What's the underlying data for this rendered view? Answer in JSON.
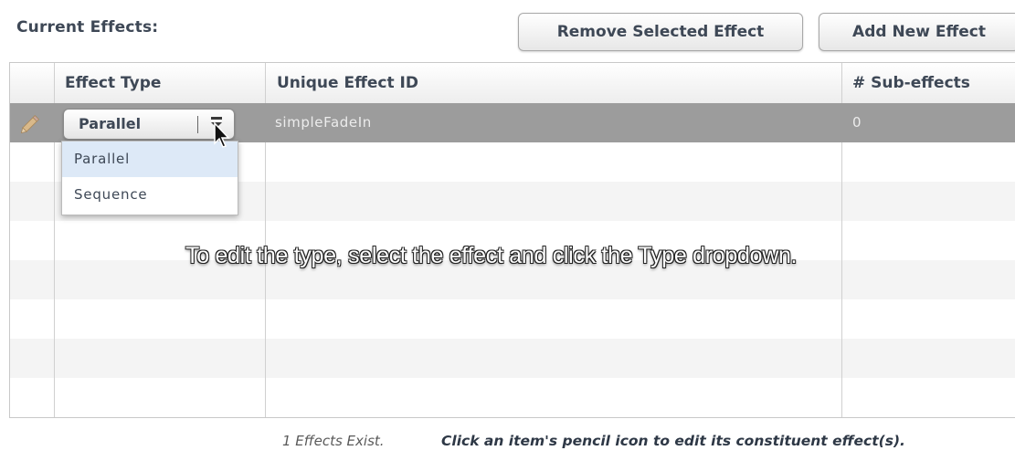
{
  "panel": {
    "title": "Current Effects:"
  },
  "toolbar": {
    "remove_label": "Remove Selected Effect",
    "add_label": "Add New Effect"
  },
  "grid": {
    "columns": [
      {
        "label": ""
      },
      {
        "label": "Effect Type"
      },
      {
        "label": "Unique Effect ID"
      },
      {
        "label": "# Sub-effects"
      }
    ],
    "rows": [
      {
        "edit_icon": "pencil-icon",
        "effect_type": "Parallel",
        "effect_id": "simpleFadeIn",
        "sub_effects": "0",
        "selected": true
      }
    ]
  },
  "dropdown": {
    "options": [
      "Parallel",
      "Sequence"
    ],
    "highlighted": "Parallel"
  },
  "caption": "To edit the type, select the effect and click the Type dropdown.",
  "footer": {
    "count_text": "1 Effects Exist.",
    "hint_text": "Click an item's pencil icon to edit its constituent effect(s)."
  },
  "colors": {
    "selected_row": "#9c9c9c",
    "header_text": "#3e4856",
    "dropdown_highlight": "#dde9f7"
  }
}
